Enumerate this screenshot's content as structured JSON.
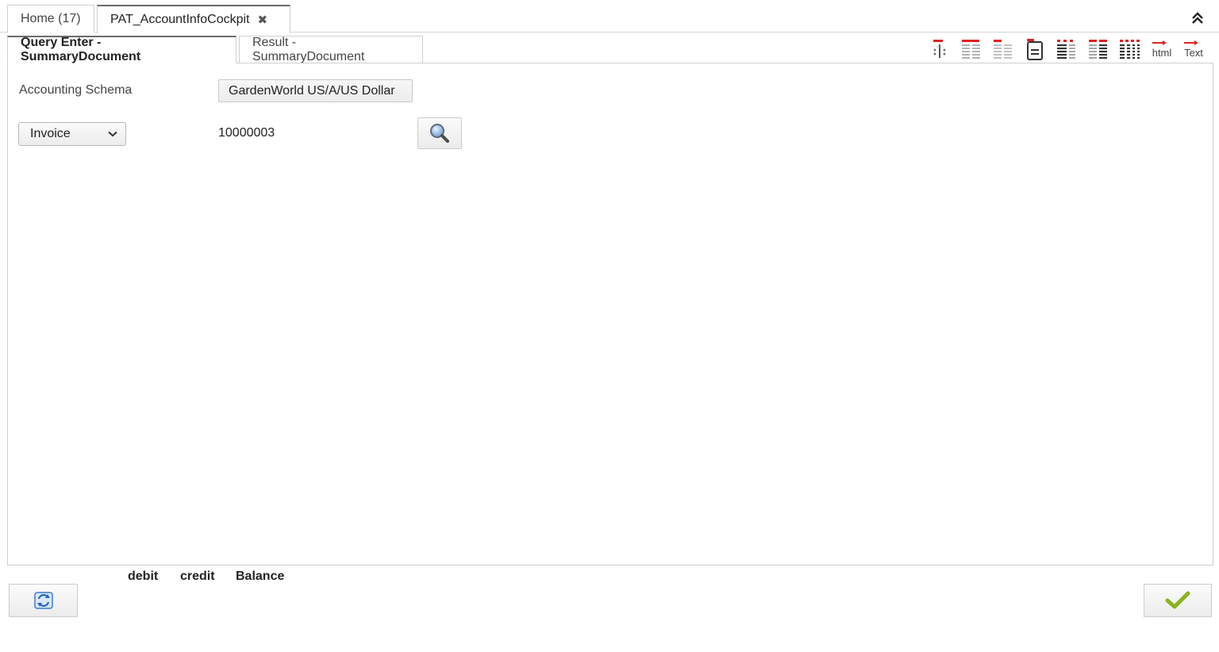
{
  "window_tabs": {
    "home_label": "Home (17)",
    "active_label": "PAT_AccountInfoCockpit",
    "close_glyph": "✖"
  },
  "sub_tabs": {
    "query_label": "Query Enter - SummaryDocument",
    "result_label": "Result - SummaryDocument"
  },
  "toolbar": {
    "icons": [
      "show-hide-column-icon",
      "insert-rows-icon",
      "delete-rows-icon",
      "document-icon",
      "insert-column-left-icon",
      "insert-column-right-icon",
      "columns-icon",
      "export-html-icon",
      "export-text-icon"
    ],
    "html_label": "html",
    "text_label": "Text"
  },
  "form": {
    "schema_label": "Accounting Schema",
    "schema_value": "GardenWorld US/A/US Dollar",
    "document_type": "Invoice",
    "document_number": "10000003"
  },
  "footer": {
    "debit_label": "debit",
    "credit_label": "credit",
    "balance_label": "Balance"
  },
  "colors": {
    "accent_red": "#e02020",
    "check_green": "#8cb31c",
    "refresh_blue": "#3a7bd5"
  }
}
